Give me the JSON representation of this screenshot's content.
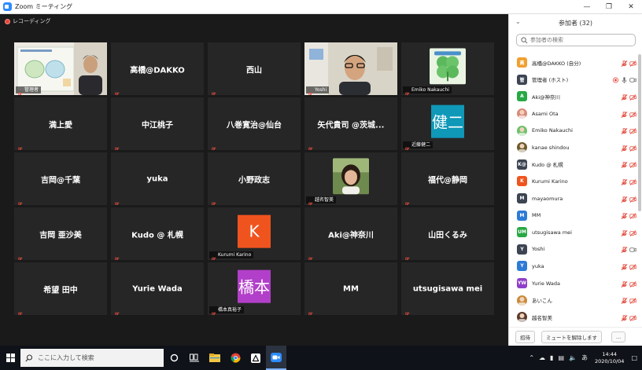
{
  "window": {
    "title": "Zoom ミーティング"
  },
  "recording": {
    "label": "レコーディング"
  },
  "tiles": [
    {
      "name": "",
      "caption": "管理者",
      "kind": "video-slides",
      "active": true
    },
    {
      "name": "高橋@DAKKO",
      "caption": "",
      "kind": "name"
    },
    {
      "name": "西山",
      "caption": "",
      "kind": "name"
    },
    {
      "name": "",
      "caption": "Yoshi",
      "kind": "video-person"
    },
    {
      "name": "",
      "caption": "Emiko Nakauchi",
      "kind": "photo-clover"
    },
    {
      "name": "満上愛",
      "caption": "",
      "kind": "name"
    },
    {
      "name": "中江桃子",
      "caption": "",
      "kind": "name"
    },
    {
      "name": "八巻寛治@仙台",
      "caption": "",
      "kind": "name"
    },
    {
      "name": "矢代貴司 @茨城...",
      "caption": "",
      "kind": "name"
    },
    {
      "name": "",
      "caption": "近藤健二",
      "kind": "avatar",
      "avatar_text": "健二",
      "color": "#0f98b8"
    },
    {
      "name": "吉岡@千葉",
      "caption": "",
      "kind": "name"
    },
    {
      "name": "yuka",
      "caption": "",
      "kind": "name"
    },
    {
      "name": "小野政志",
      "caption": "",
      "kind": "name"
    },
    {
      "name": "",
      "caption": "越名智美",
      "kind": "photo-woman"
    },
    {
      "name": "福代@静岡",
      "caption": "",
      "kind": "name"
    },
    {
      "name": "吉岡 亜沙美",
      "caption": "",
      "kind": "name"
    },
    {
      "name": "Kudo @ 札幌",
      "caption": "",
      "kind": "name"
    },
    {
      "name": "",
      "caption": "Kurumi Karino",
      "kind": "avatar",
      "avatar_text": "K",
      "color": "#f0541e"
    },
    {
      "name": "Aki@神奈川",
      "caption": "",
      "kind": "name"
    },
    {
      "name": "山田くるみ",
      "caption": "",
      "kind": "name"
    },
    {
      "name": "希望 田中",
      "caption": "",
      "kind": "name"
    },
    {
      "name": "Yurie Wada",
      "caption": "",
      "kind": "name"
    },
    {
      "name": "",
      "caption": "橋本真裕子",
      "kind": "avatar",
      "avatar_text": "橋本",
      "color": "#b23fc9"
    },
    {
      "name": "MM",
      "caption": "",
      "kind": "name"
    },
    {
      "name": "utsugisawa mei",
      "caption": "",
      "kind": "name"
    }
  ],
  "panel": {
    "title": "参加者 (32)",
    "search_placeholder": "参加者の検索",
    "participants": [
      {
        "name": "高橋@DAKKO (自分)",
        "initial": "高",
        "color": "#f0a030",
        "host": false
      },
      {
        "name": "管理者 (ホスト)",
        "initial": "管",
        "color": "#3d4452",
        "host": true
      },
      {
        "name": "Aki@神奈川",
        "initial": "A",
        "color": "#27a844"
      },
      {
        "name": "Asami Ota",
        "initial": "",
        "color": "#d98a7a",
        "photo": true
      },
      {
        "name": "Emiko Nakauchi",
        "initial": "",
        "color": "#6ec16b",
        "photo": true
      },
      {
        "name": "kanae shindou",
        "initial": "",
        "color": "#6b5a2a",
        "photo": true
      },
      {
        "name": "Kudo @ 札幌",
        "initial": "K@",
        "color": "#3d4452"
      },
      {
        "name": "Kurumi Karino",
        "initial": "K",
        "color": "#f0541e"
      },
      {
        "name": "mayaomura",
        "initial": "M",
        "color": "#3d4452"
      },
      {
        "name": "MM",
        "initial": "M",
        "color": "#2d7bd6"
      },
      {
        "name": "utsugisawa mei",
        "initial": "UM",
        "color": "#27a844"
      },
      {
        "name": "Yoshi",
        "initial": "Y",
        "color": "#3d4452",
        "video_off": true
      },
      {
        "name": "yuka",
        "initial": "Y",
        "color": "#2d7bd6"
      },
      {
        "name": "Yurie Wada",
        "initial": "YW",
        "color": "#8e3fc9"
      },
      {
        "name": "あいこん",
        "initial": "",
        "color": "#c98a3a",
        "photo": true
      },
      {
        "name": "越名智美",
        "initial": "",
        "color": "#5a3a2a",
        "photo": true
      }
    ],
    "invite_label": "招待",
    "unmute_all_label": "ミュートを解除します",
    "more_label": "..."
  },
  "taskbar": {
    "search_placeholder": "ここに入力して検索",
    "time": "14:44",
    "date": "2020/10/04",
    "ime": "あ"
  }
}
